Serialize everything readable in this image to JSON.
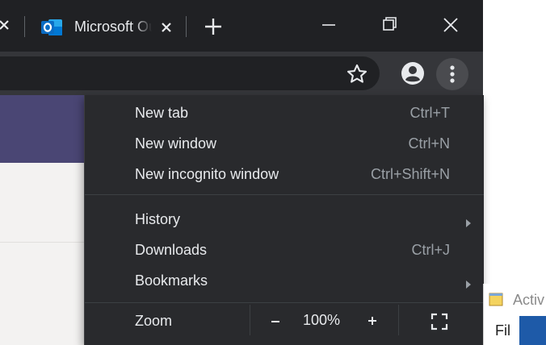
{
  "tabstrip": {
    "tab_title": "Microsoft Outlook"
  },
  "menu": {
    "items": [
      {
        "label": "New tab",
        "shortcut": "Ctrl+T"
      },
      {
        "label": "New window",
        "shortcut": "Ctrl+N"
      },
      {
        "label": "New incognito window",
        "shortcut": "Ctrl+Shift+N"
      },
      {
        "label": "History",
        "shortcut": ""
      },
      {
        "label": "Downloads",
        "shortcut": "Ctrl+J"
      },
      {
        "label": "Bookmarks",
        "shortcut": ""
      }
    ],
    "zoom": {
      "label": "Zoom",
      "minus": "–",
      "value": "100%",
      "plus": "+"
    }
  },
  "background_window": {
    "title": "Activ",
    "menu_label": "Fil"
  },
  "colors": {
    "titlebar": "#202124",
    "toolbar": "#35363a",
    "menu_bg": "#292a2d",
    "menu_text": "#e8eaed",
    "shortcut_text": "#9aa0a6",
    "outlook_blue": "#0a6cc4",
    "page_band": "#4a4674"
  },
  "icons": [
    "close-icon",
    "outlook-icon",
    "plus-icon",
    "minimize-icon",
    "restore-icon",
    "star-icon",
    "account-icon",
    "more-vert-icon",
    "chevron-right-icon",
    "fullscreen-icon"
  ]
}
